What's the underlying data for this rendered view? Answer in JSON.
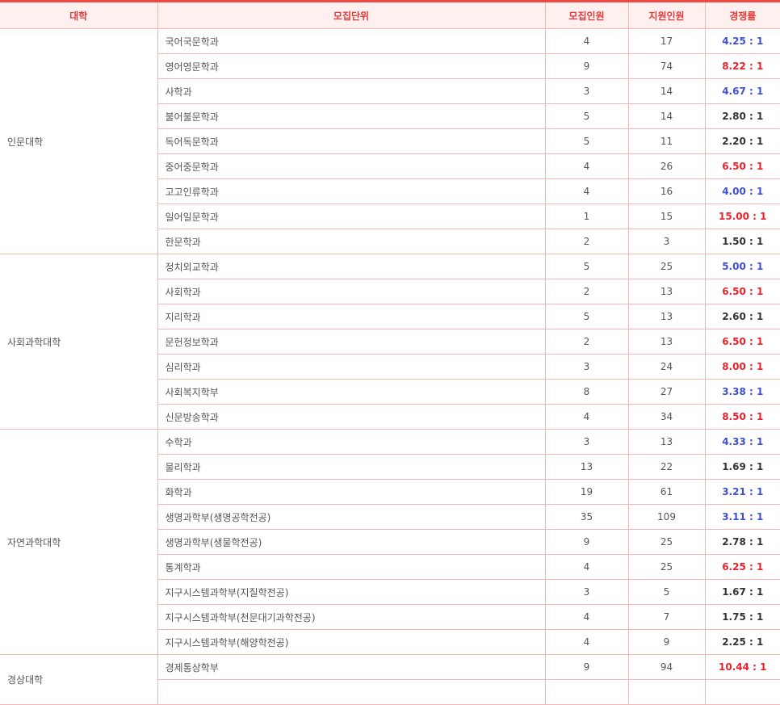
{
  "headers": [
    "대학",
    "모집단위",
    "모집인원",
    "지원인원",
    "경쟁률"
  ],
  "colors": {
    "blue": "#3f4fcf",
    "red": "#e8212b",
    "dark": "#333333",
    "header_text": "#e23b3b",
    "border": "#f3b6b2"
  },
  "groups": [
    {
      "college": "인문대학",
      "rows": [
        {
          "unit": "국어국문학과",
          "quota": "4",
          "applicants": "17",
          "rate": "4.25 : 1",
          "color": "blue"
        },
        {
          "unit": "영어영문학과",
          "quota": "9",
          "applicants": "74",
          "rate": "8.22 : 1",
          "color": "red"
        },
        {
          "unit": "사학과",
          "quota": "3",
          "applicants": "14",
          "rate": "4.67 : 1",
          "color": "blue"
        },
        {
          "unit": "불어불문학과",
          "quota": "5",
          "applicants": "14",
          "rate": "2.80 : 1",
          "color": "dark"
        },
        {
          "unit": "독어독문학과",
          "quota": "5",
          "applicants": "11",
          "rate": "2.20 : 1",
          "color": "dark"
        },
        {
          "unit": "중어중문학과",
          "quota": "4",
          "applicants": "26",
          "rate": "6.50 : 1",
          "color": "red"
        },
        {
          "unit": "고고인류학과",
          "quota": "4",
          "applicants": "16",
          "rate": "4.00 : 1",
          "color": "blue"
        },
        {
          "unit": "일어일문학과",
          "quota": "1",
          "applicants": "15",
          "rate": "15.00 : 1",
          "color": "red"
        },
        {
          "unit": "한문학과",
          "quota": "2",
          "applicants": "3",
          "rate": "1.50 : 1",
          "color": "dark"
        }
      ]
    },
    {
      "college": "사회과학대학",
      "rows": [
        {
          "unit": "정치외교학과",
          "quota": "5",
          "applicants": "25",
          "rate": "5.00 : 1",
          "color": "blue"
        },
        {
          "unit": "사회학과",
          "quota": "2",
          "applicants": "13",
          "rate": "6.50 : 1",
          "color": "red"
        },
        {
          "unit": "지리학과",
          "quota": "5",
          "applicants": "13",
          "rate": "2.60 : 1",
          "color": "dark"
        },
        {
          "unit": "문헌정보학과",
          "quota": "2",
          "applicants": "13",
          "rate": "6.50 : 1",
          "color": "red"
        },
        {
          "unit": "심리학과",
          "quota": "3",
          "applicants": "24",
          "rate": "8.00 : 1",
          "color": "red"
        },
        {
          "unit": "사회복지학부",
          "quota": "8",
          "applicants": "27",
          "rate": "3.38 : 1",
          "color": "blue"
        },
        {
          "unit": "신문방송학과",
          "quota": "4",
          "applicants": "34",
          "rate": "8.50 : 1",
          "color": "red"
        }
      ]
    },
    {
      "college": "자연과학대학",
      "rows": [
        {
          "unit": "수학과",
          "quota": "3",
          "applicants": "13",
          "rate": "4.33 : 1",
          "color": "blue"
        },
        {
          "unit": "물리학과",
          "quota": "13",
          "applicants": "22",
          "rate": "1.69 : 1",
          "color": "dark"
        },
        {
          "unit": "화학과",
          "quota": "19",
          "applicants": "61",
          "rate": "3.21 : 1",
          "color": "blue"
        },
        {
          "unit": "생명과학부(생명공학전공)",
          "quota": "35",
          "applicants": "109",
          "rate": "3.11 : 1",
          "color": "blue"
        },
        {
          "unit": "생명과학부(생물학전공)",
          "quota": "9",
          "applicants": "25",
          "rate": "2.78 : 1",
          "color": "dark"
        },
        {
          "unit": "통계학과",
          "quota": "4",
          "applicants": "25",
          "rate": "6.25 : 1",
          "color": "red"
        },
        {
          "unit": "지구시스템과학부(지질학전공)",
          "quota": "3",
          "applicants": "5",
          "rate": "1.67 : 1",
          "color": "dark"
        },
        {
          "unit": "지구시스템과학부(천문대기과학전공)",
          "quota": "4",
          "applicants": "7",
          "rate": "1.75 : 1",
          "color": "dark"
        },
        {
          "unit": "지구시스템과학부(해양학전공)",
          "quota": "4",
          "applicants": "9",
          "rate": "2.25 : 1",
          "color": "dark"
        }
      ]
    },
    {
      "college": "경상대학",
      "rows": [
        {
          "unit": "경제통상학부",
          "quota": "9",
          "applicants": "94",
          "rate": "10.44 : 1",
          "color": "red"
        },
        {
          "unit": "",
          "quota": "",
          "applicants": "",
          "rate": "",
          "color": "dark"
        }
      ]
    }
  ]
}
